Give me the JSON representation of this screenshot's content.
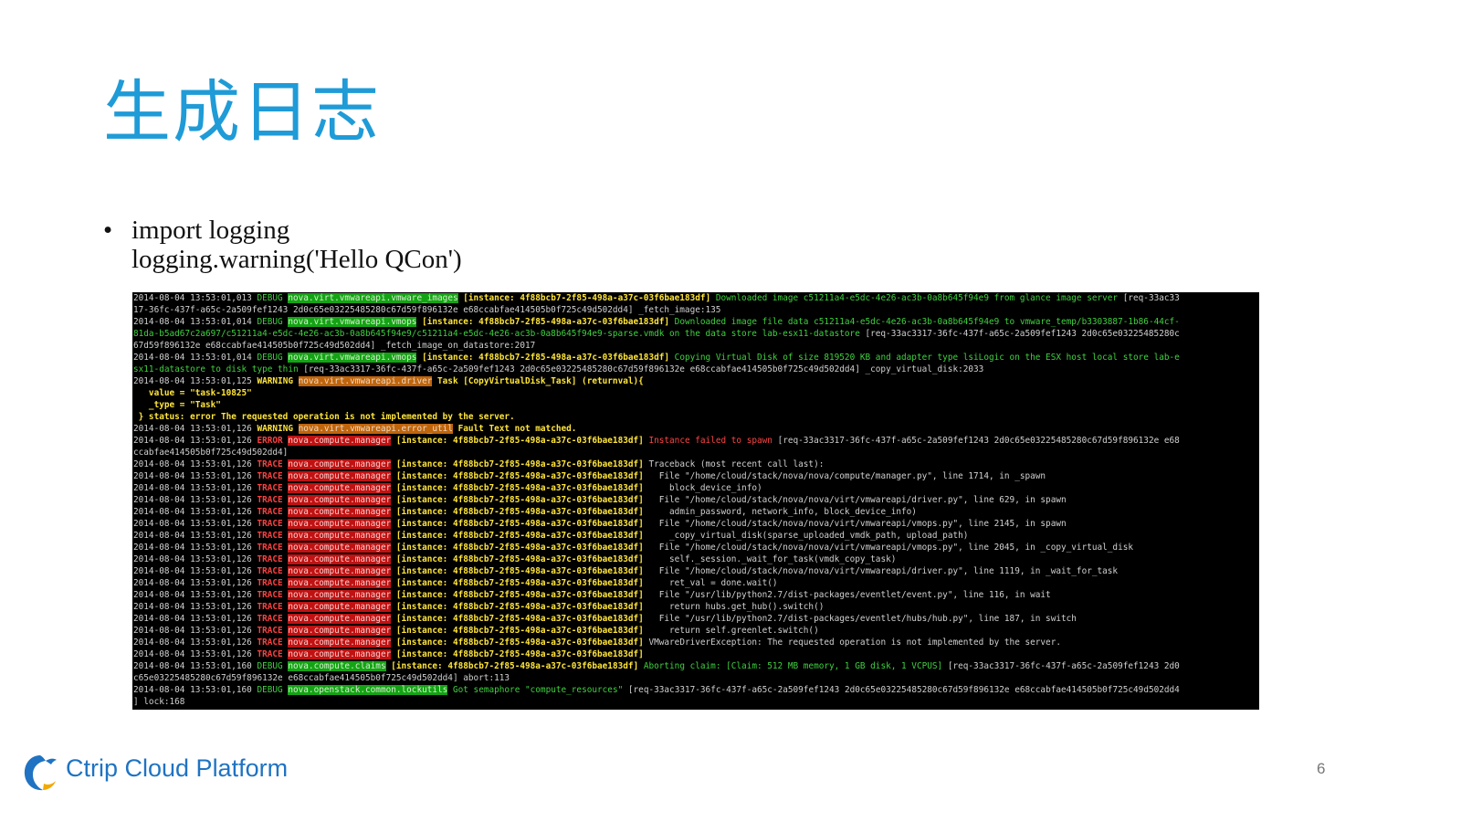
{
  "slide": {
    "title": "生成日志",
    "bullet": "•",
    "code_lines": [
      "import logging",
      "logging.warning('Hello QCon')"
    ],
    "page_number": "6"
  },
  "footer": {
    "brand": "Ctrip Cloud Platform",
    "logo_icon": "dolphin-logo-icon"
  },
  "colors": {
    "title": "#1f9bd7",
    "brand": "#1f73c2",
    "debug": "#3fd13f",
    "warning": "#ffe53a",
    "error": "#ff4040"
  },
  "terminal": {
    "lines": [
      [
        {
          "t": "2014-08-04 13:53:01,013 ",
          "c": "ts"
        },
        {
          "t": "DEBUG ",
          "c": "lv-debug"
        },
        {
          "t": "nova.virt.vmwareapi.vmware_images",
          "c": "mod-g"
        },
        {
          "t": " [instance: 4f88bcb7-2f85-498a-a37c-03f6bae183df] ",
          "c": "inst"
        },
        {
          "t": "Downloaded image c51211a4-e5dc-4e26-ac3b-0a8b645f94e9 from glance image server ",
          "c": "gtxt"
        },
        {
          "t": "[req-33ac33",
          "c": "wtxt"
        }
      ],
      [
        {
          "t": "17-36fc-437f-a65c-2a509fef1243 2d0c65e03225485280c67d59f896132e e68ccabfae414505b0f725c49d502dd4] _fetch_image:135",
          "c": "wtxt"
        }
      ],
      [
        {
          "t": "2014-08-04 13:53:01,014 ",
          "c": "ts"
        },
        {
          "t": "DEBUG ",
          "c": "lv-debug"
        },
        {
          "t": "nova.virt.vmwareapi.vmops",
          "c": "mod-g"
        },
        {
          "t": " [instance: 4f88bcb7-2f85-498a-a37c-03f6bae183df] ",
          "c": "inst"
        },
        {
          "t": "Downloaded image file data c51211a4-e5dc-4e26-ac3b-0a8b645f94e9 to vmware_temp/b3303887-1b86-44cf-",
          "c": "gtxt"
        }
      ],
      [
        {
          "t": "81da-b5ad67c2a697/c51211a4-e5dc-4e26-ac3b-0a8b645f94e9/c51211a4-e5dc-4e26-ac3b-0a8b645f94e9-sparse.vmdk on the data store lab-esx11-datastore ",
          "c": "gtxt"
        },
        {
          "t": "[req-33ac3317-36fc-437f-a65c-2a509fef1243 2d0c65e03225485280c",
          "c": "wtxt"
        }
      ],
      [
        {
          "t": "67d59f896132e e68ccabfae414505b0f725c49d502dd4] _fetch_image_on_datastore:2017",
          "c": "wtxt"
        }
      ],
      [
        {
          "t": "2014-08-04 13:53:01,014 ",
          "c": "ts"
        },
        {
          "t": "DEBUG ",
          "c": "lv-debug"
        },
        {
          "t": "nova.virt.vmwareapi.vmops",
          "c": "mod-g"
        },
        {
          "t": " [instance: 4f88bcb7-2f85-498a-a37c-03f6bae183df] ",
          "c": "inst"
        },
        {
          "t": "Copying Virtual Disk of size 819520 KB and adapter type lsiLogic on the ESX host local store lab-e",
          "c": "gtxt"
        }
      ],
      [
        {
          "t": "sx11-datastore to disk type thin ",
          "c": "gtxt"
        },
        {
          "t": "[req-33ac3317-36fc-437f-a65c-2a509fef1243 2d0c65e03225485280c67d59f896132e e68ccabfae414505b0f725c49d502dd4] _copy_virtual_disk:2033",
          "c": "wtxt"
        }
      ],
      [
        {
          "t": "2014-08-04 13:53:01,125 ",
          "c": "ts"
        },
        {
          "t": "WARNING ",
          "c": "lv-warn"
        },
        {
          "t": "nova.virt.vmwareapi.driver",
          "c": "mod-o"
        },
        {
          "t": " Task [CopyVirtualDisk_Task] (returnval){",
          "c": "ytxt"
        }
      ],
      [
        {
          "t": "   value = \"task-10825\"",
          "c": "ytxt"
        }
      ],
      [
        {
          "t": "   _type = \"Task\"",
          "c": "ytxt"
        }
      ],
      [
        {
          "t": " } status: error The requested operation is not implemented by the server.",
          "c": "ytxt"
        }
      ],
      [
        {
          "t": "2014-08-04 13:53:01,126 ",
          "c": "ts"
        },
        {
          "t": "WARNING ",
          "c": "lv-warn"
        },
        {
          "t": "nova.virt.vmwareapi.error_util",
          "c": "mod-o"
        },
        {
          "t": " Fault Text not matched.",
          "c": "ytxt"
        }
      ],
      [
        {
          "t": "2014-08-04 13:53:01,126 ",
          "c": "ts"
        },
        {
          "t": "ERROR ",
          "c": "lv-err"
        },
        {
          "t": "nova.compute.manager",
          "c": "mod-r"
        },
        {
          "t": " [instance: 4f88bcb7-2f85-498a-a37c-03f6bae183df] ",
          "c": "inst"
        },
        {
          "t": "Instance failed to spawn ",
          "c": "rtxt"
        },
        {
          "t": "[req-33ac3317-36fc-437f-a65c-2a509fef1243 2d0c65e03225485280c67d59f896132e e68",
          "c": "wtxt"
        }
      ],
      [
        {
          "t": "ccabfae414505b0f725c49d502dd4]",
          "c": "wtxt"
        }
      ],
      [
        {
          "t": "2014-08-04 13:53:01,126 ",
          "c": "ts"
        },
        {
          "t": "TRACE ",
          "c": "lv-trace"
        },
        {
          "t": "nova.compute.manager",
          "c": "mod-r"
        },
        {
          "t": " [instance: 4f88bcb7-2f85-498a-a37c-03f6bae183df] ",
          "c": "inst"
        },
        {
          "t": "Traceback (most recent call last):",
          "c": "wtxt"
        }
      ],
      [
        {
          "t": "2014-08-04 13:53:01,126 ",
          "c": "ts"
        },
        {
          "t": "TRACE ",
          "c": "lv-trace"
        },
        {
          "t": "nova.compute.manager",
          "c": "mod-r"
        },
        {
          "t": " [instance: 4f88bcb7-2f85-498a-a37c-03f6bae183df] ",
          "c": "inst"
        },
        {
          "t": "  File \"/home/cloud/stack/nova/nova/compute/manager.py\", line 1714, in _spawn",
          "c": "wtxt"
        }
      ],
      [
        {
          "t": "2014-08-04 13:53:01,126 ",
          "c": "ts"
        },
        {
          "t": "TRACE ",
          "c": "lv-trace"
        },
        {
          "t": "nova.compute.manager",
          "c": "mod-r"
        },
        {
          "t": " [instance: 4f88bcb7-2f85-498a-a37c-03f6bae183df] ",
          "c": "inst"
        },
        {
          "t": "    block_device_info)",
          "c": "wtxt"
        }
      ],
      [
        {
          "t": "2014-08-04 13:53:01,126 ",
          "c": "ts"
        },
        {
          "t": "TRACE ",
          "c": "lv-trace"
        },
        {
          "t": "nova.compute.manager",
          "c": "mod-r"
        },
        {
          "t": " [instance: 4f88bcb7-2f85-498a-a37c-03f6bae183df] ",
          "c": "inst"
        },
        {
          "t": "  File \"/home/cloud/stack/nova/nova/virt/vmwareapi/driver.py\", line 629, in spawn",
          "c": "wtxt"
        }
      ],
      [
        {
          "t": "2014-08-04 13:53:01,126 ",
          "c": "ts"
        },
        {
          "t": "TRACE ",
          "c": "lv-trace"
        },
        {
          "t": "nova.compute.manager",
          "c": "mod-r"
        },
        {
          "t": " [instance: 4f88bcb7-2f85-498a-a37c-03f6bae183df] ",
          "c": "inst"
        },
        {
          "t": "    admin_password, network_info, block_device_info)",
          "c": "wtxt"
        }
      ],
      [
        {
          "t": "2014-08-04 13:53:01,126 ",
          "c": "ts"
        },
        {
          "t": "TRACE ",
          "c": "lv-trace"
        },
        {
          "t": "nova.compute.manager",
          "c": "mod-r"
        },
        {
          "t": " [instance: 4f88bcb7-2f85-498a-a37c-03f6bae183df] ",
          "c": "inst"
        },
        {
          "t": "  File \"/home/cloud/stack/nova/nova/virt/vmwareapi/vmops.py\", line 2145, in spawn",
          "c": "wtxt"
        }
      ],
      [
        {
          "t": "2014-08-04 13:53:01,126 ",
          "c": "ts"
        },
        {
          "t": "TRACE ",
          "c": "lv-trace"
        },
        {
          "t": "nova.compute.manager",
          "c": "mod-r"
        },
        {
          "t": " [instance: 4f88bcb7-2f85-498a-a37c-03f6bae183df] ",
          "c": "inst"
        },
        {
          "t": "    _copy_virtual_disk(sparse_uploaded_vmdk_path, upload_path)",
          "c": "wtxt"
        }
      ],
      [
        {
          "t": "2014-08-04 13:53:01,126 ",
          "c": "ts"
        },
        {
          "t": "TRACE ",
          "c": "lv-trace"
        },
        {
          "t": "nova.compute.manager",
          "c": "mod-r"
        },
        {
          "t": " [instance: 4f88bcb7-2f85-498a-a37c-03f6bae183df] ",
          "c": "inst"
        },
        {
          "t": "  File \"/home/cloud/stack/nova/nova/virt/vmwareapi/vmops.py\", line 2045, in _copy_virtual_disk",
          "c": "wtxt"
        }
      ],
      [
        {
          "t": "2014-08-04 13:53:01,126 ",
          "c": "ts"
        },
        {
          "t": "TRACE ",
          "c": "lv-trace"
        },
        {
          "t": "nova.compute.manager",
          "c": "mod-r"
        },
        {
          "t": " [instance: 4f88bcb7-2f85-498a-a37c-03f6bae183df] ",
          "c": "inst"
        },
        {
          "t": "    self._session._wait_for_task(vmdk_copy_task)",
          "c": "wtxt"
        }
      ],
      [
        {
          "t": "2014-08-04 13:53:01,126 ",
          "c": "ts"
        },
        {
          "t": "TRACE ",
          "c": "lv-trace"
        },
        {
          "t": "nova.compute.manager",
          "c": "mod-r"
        },
        {
          "t": " [instance: 4f88bcb7-2f85-498a-a37c-03f6bae183df] ",
          "c": "inst"
        },
        {
          "t": "  File \"/home/cloud/stack/nova/nova/virt/vmwareapi/driver.py\", line 1119, in _wait_for_task",
          "c": "wtxt"
        }
      ],
      [
        {
          "t": "2014-08-04 13:53:01,126 ",
          "c": "ts"
        },
        {
          "t": "TRACE ",
          "c": "lv-trace"
        },
        {
          "t": "nova.compute.manager",
          "c": "mod-r"
        },
        {
          "t": " [instance: 4f88bcb7-2f85-498a-a37c-03f6bae183df] ",
          "c": "inst"
        },
        {
          "t": "    ret_val = done.wait()",
          "c": "wtxt"
        }
      ],
      [
        {
          "t": "2014-08-04 13:53:01,126 ",
          "c": "ts"
        },
        {
          "t": "TRACE ",
          "c": "lv-trace"
        },
        {
          "t": "nova.compute.manager",
          "c": "mod-r"
        },
        {
          "t": " [instance: 4f88bcb7-2f85-498a-a37c-03f6bae183df] ",
          "c": "inst"
        },
        {
          "t": "  File \"/usr/lib/python2.7/dist-packages/eventlet/event.py\", line 116, in wait",
          "c": "wtxt"
        }
      ],
      [
        {
          "t": "2014-08-04 13:53:01,126 ",
          "c": "ts"
        },
        {
          "t": "TRACE ",
          "c": "lv-trace"
        },
        {
          "t": "nova.compute.manager",
          "c": "mod-r"
        },
        {
          "t": " [instance: 4f88bcb7-2f85-498a-a37c-03f6bae183df] ",
          "c": "inst"
        },
        {
          "t": "    return hubs.get_hub().switch()",
          "c": "wtxt"
        }
      ],
      [
        {
          "t": "2014-08-04 13:53:01,126 ",
          "c": "ts"
        },
        {
          "t": "TRACE ",
          "c": "lv-trace"
        },
        {
          "t": "nova.compute.manager",
          "c": "mod-r"
        },
        {
          "t": " [instance: 4f88bcb7-2f85-498a-a37c-03f6bae183df] ",
          "c": "inst"
        },
        {
          "t": "  File \"/usr/lib/python2.7/dist-packages/eventlet/hubs/hub.py\", line 187, in switch",
          "c": "wtxt"
        }
      ],
      [
        {
          "t": "2014-08-04 13:53:01,126 ",
          "c": "ts"
        },
        {
          "t": "TRACE ",
          "c": "lv-trace"
        },
        {
          "t": "nova.compute.manager",
          "c": "mod-r"
        },
        {
          "t": " [instance: 4f88bcb7-2f85-498a-a37c-03f6bae183df] ",
          "c": "inst"
        },
        {
          "t": "    return self.greenlet.switch()",
          "c": "wtxt"
        }
      ],
      [
        {
          "t": "2014-08-04 13:53:01,126 ",
          "c": "ts"
        },
        {
          "t": "TRACE ",
          "c": "lv-trace"
        },
        {
          "t": "nova.compute.manager",
          "c": "mod-r"
        },
        {
          "t": " [instance: 4f88bcb7-2f85-498a-a37c-03f6bae183df] ",
          "c": "inst"
        },
        {
          "t": "VMwareDriverException: The requested operation is not implemented by the server.",
          "c": "wtxt"
        }
      ],
      [
        {
          "t": "2014-08-04 13:53:01,126 ",
          "c": "ts"
        },
        {
          "t": "TRACE ",
          "c": "lv-trace"
        },
        {
          "t": "nova.compute.manager",
          "c": "mod-r"
        },
        {
          "t": " [instance: 4f88bcb7-2f85-498a-a37c-03f6bae183df]",
          "c": "inst"
        }
      ],
      [
        {
          "t": "2014-08-04 13:53:01,160 ",
          "c": "ts"
        },
        {
          "t": "DEBUG ",
          "c": "lv-debug"
        },
        {
          "t": "nova.compute.claims",
          "c": "mod-g"
        },
        {
          "t": " [instance: 4f88bcb7-2f85-498a-a37c-03f6bae183df] ",
          "c": "inst"
        },
        {
          "t": "Aborting claim: [Claim: 512 MB memory, 1 GB disk, 1 VCPUS] ",
          "c": "gtxt"
        },
        {
          "t": "[req-33ac3317-36fc-437f-a65c-2a509fef1243 2d0",
          "c": "wtxt"
        }
      ],
      [
        {
          "t": "c65e03225485280c67d59f896132e e68ccabfae414505b0f725c49d502dd4] abort:113",
          "c": "wtxt"
        }
      ],
      [
        {
          "t": "2014-08-04 13:53:01,160 ",
          "c": "ts"
        },
        {
          "t": "DEBUG ",
          "c": "lv-debug"
        },
        {
          "t": "nova.openstack.common.lockutils",
          "c": "mod-g"
        },
        {
          "t": " Got semaphore \"compute_resources\" ",
          "c": "gtxt"
        },
        {
          "t": "[req-33ac3317-36fc-437f-a65c-2a509fef1243 2d0c65e03225485280c67d59f896132e e68ccabfae414505b0f725c49d502dd4",
          "c": "wtxt"
        }
      ],
      [
        {
          "t": "] lock:168",
          "c": "wtxt"
        }
      ]
    ]
  }
}
